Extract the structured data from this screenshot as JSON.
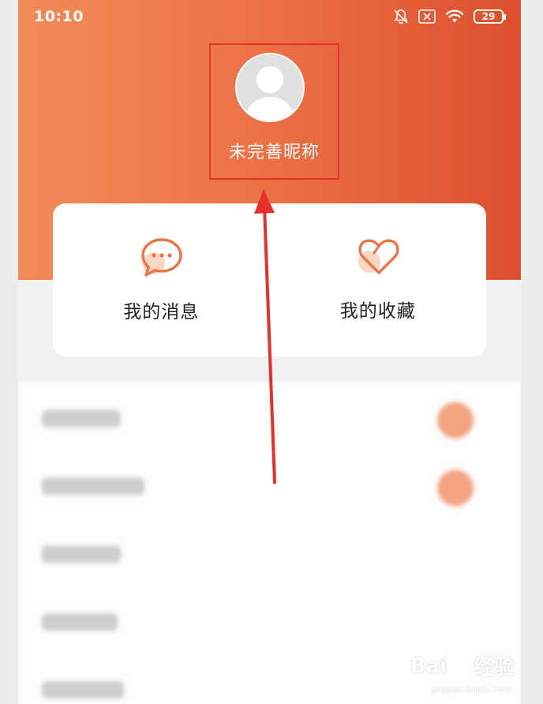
{
  "status_bar": {
    "time": "10:10",
    "battery_level": "29",
    "icons": [
      "bell-muted-icon",
      "sim-x-icon",
      "wifi-icon",
      "battery-icon"
    ]
  },
  "profile": {
    "nickname": "未完善昵称",
    "avatar_icon": "default-avatar-icon"
  },
  "actions": [
    {
      "label": "我的消息",
      "icon": "chat-bubble-icon"
    },
    {
      "label": "我的收藏",
      "icon": "heart-icon"
    }
  ],
  "colors": {
    "header_gradient_start": "#f28b57",
    "header_gradient_end": "#de4f2d",
    "accent_orange": "#ec7447",
    "annotation_red": "#e8302b"
  },
  "watermark": {
    "brand": "Bai",
    "brand_suffix": "经验",
    "url": "jingyan.baidu.com"
  }
}
